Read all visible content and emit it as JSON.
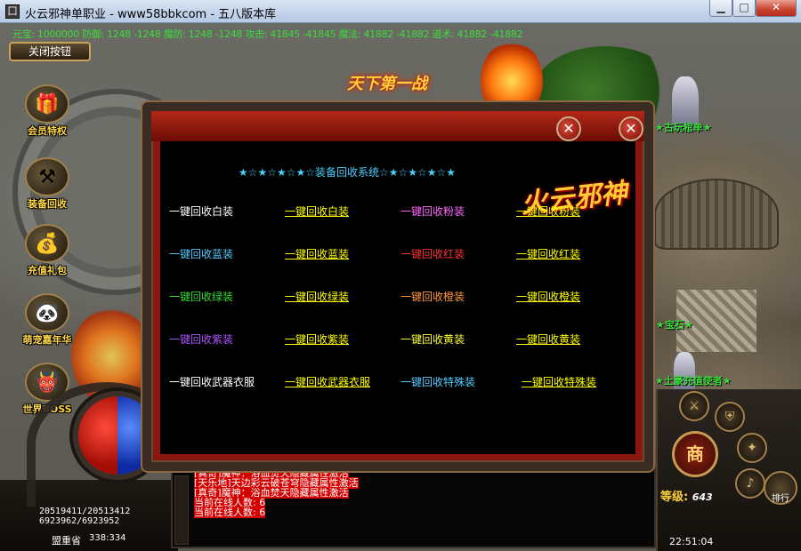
{
  "window": {
    "title": "火云邪神单职业 - www58bbkcom - 五八版本库",
    "min_glyph": "▁",
    "max_glyph": "□",
    "close_glyph": "✕"
  },
  "stats": {
    "text": "元宝: 1000000 防御: 1248 -1248 魔防: 1248 -1248 攻击: 41845 -41845 魔法: 41882 -41882 道术: 41882 -41882"
  },
  "top_left_button": "关闭按钮",
  "banner": "天下第一战",
  "side_menu": [
    {
      "label": "会员特权",
      "icon": "gift-icon",
      "glyph": "🎁"
    },
    {
      "label": "装备回收",
      "icon": "axe-icon",
      "glyph": "⚒"
    },
    {
      "label": "充值礼包",
      "icon": "treasure-icon",
      "glyph": "💰"
    },
    {
      "label": "萌宠嘉年华",
      "icon": "panda-icon",
      "glyph": "🐼"
    },
    {
      "label": "世界BOSS",
      "icon": "boss-icon",
      "glyph": "👹"
    }
  ],
  "player": {
    "hp": "20519411/20513412",
    "mp": "6923962/6923952",
    "map": "盟重省",
    "coords": "338:334",
    "level_label": "等级:",
    "level": "643",
    "clock": "22:51:04"
  },
  "npcs": [
    "★古玩棺单★",
    "★土豪充值使者★",
    "★宝石★"
  ],
  "chat": [
    "[真奇]魔神：浴血焚天隐藏属性激活",
    "[天乐地]天边彩云破苍穹隐藏属性激活",
    "[真奇]魔神：浴血焚天隐藏属性激活",
    "当前在线人数: 6",
    "当前在线人数: 6"
  ],
  "right_panel": {
    "shop": "商",
    "ranking": "排行"
  },
  "dialog": {
    "title": "★☆★☆★☆★☆装备回收系统☆★☆★☆★☆★",
    "logo": "火云邪神",
    "rows": [
      [
        {
          "t": "一键回收白装",
          "c": "#ffffff"
        },
        {
          "t": "一键回收白装",
          "c": "#ffff00"
        },
        {
          "t": "一键回收粉装",
          "c": "#ff66ff"
        },
        {
          "t": "一键回收粉装",
          "c": "#ffff00"
        }
      ],
      [
        {
          "t": "一键回收蓝装",
          "c": "#55ccff"
        },
        {
          "t": "一键回收蓝装",
          "c": "#ffff00"
        },
        {
          "t": "一键回收红装",
          "c": "#ff3333"
        },
        {
          "t": "一键回收红装",
          "c": "#ffff00"
        }
      ],
      [
        {
          "t": "一键回收绿装",
          "c": "#33dd33"
        },
        {
          "t": "一键回收绿装",
          "c": "#ffff00"
        },
        {
          "t": "一键回收橙装",
          "c": "#ff9933"
        },
        {
          "t": "一键回收橙装",
          "c": "#ffff00"
        }
      ],
      [
        {
          "t": "一键回收紫装",
          "c": "#aa55ff"
        },
        {
          "t": "一键回收紫装",
          "c": "#ffff00"
        },
        {
          "t": "一键回收黄装",
          "c": "#ffff33"
        },
        {
          "t": "一键回收黄装",
          "c": "#ffff00"
        }
      ],
      [
        {
          "t": "一键回收武器衣服",
          "c": "#ffffff"
        },
        {
          "t": "一键回收武器衣服",
          "c": "#ffff00"
        },
        {
          "t": "一键回收特殊装",
          "c": "#55ccff"
        },
        {
          "t": "一键回收特殊装",
          "c": "#ffff00"
        }
      ]
    ]
  }
}
